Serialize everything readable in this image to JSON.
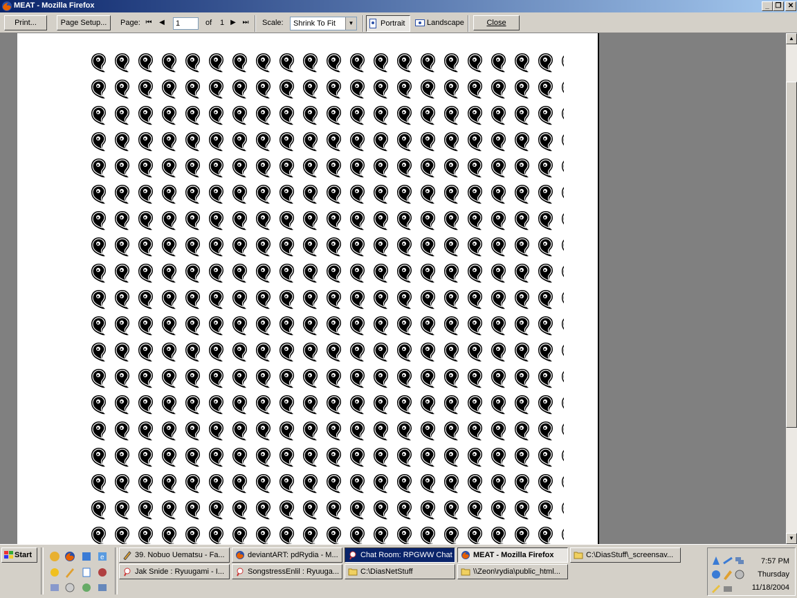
{
  "window": {
    "title": "MEAT - Mozilla Firefox",
    "minimize": "_",
    "restore": "❐",
    "close": "✕"
  },
  "toolbar": {
    "print_label": "Print...",
    "page_setup_label": "Page Setup...",
    "page_label": "Page:",
    "page_value": "1",
    "of_label": "of",
    "total_pages": "1",
    "scale_label": "Scale:",
    "scale_value": "Shrink To Fit",
    "portrait_label": "Portrait",
    "landscape_label": "Landscape",
    "close_label": "Close"
  },
  "colors": {
    "titlebar_start": "#0a246a",
    "titlebar_end": "#a6caf0",
    "preview_background": "#808080",
    "active_task": "#0a246a"
  },
  "taskbar": {
    "start_label": "Start",
    "tasks_row1": [
      {
        "label": "39. Nobuo Uematsu - Fa...",
        "icon": "winamp-icon"
      },
      {
        "label": "deviantART: pdRydia - M...",
        "icon": "firefox-icon"
      },
      {
        "label": "Chat Room: RPGWW Chat",
        "icon": "chat-icon",
        "state": "active"
      },
      {
        "label": "MEAT - Mozilla Firefox",
        "icon": "firefox-icon",
        "state": "pressed"
      },
      {
        "label": "C:\\DiasStuff\\_screensav...",
        "icon": "folder-icon"
      }
    ],
    "tasks_row2": [
      {
        "label": "Jak Snide : Ryuugami - I...",
        "icon": "im-icon"
      },
      {
        "label": "SongstressEnlil : Ryuuga...",
        "icon": "im-icon"
      },
      {
        "label": "C:\\DiasNetStuff",
        "icon": "folder-icon"
      },
      {
        "label": "\\\\Zeon\\rydia\\public_html...",
        "icon": "folder-icon"
      }
    ],
    "clock": {
      "time": "7:57 PM",
      "day": "Thursday",
      "date": "11/18/2004"
    }
  }
}
